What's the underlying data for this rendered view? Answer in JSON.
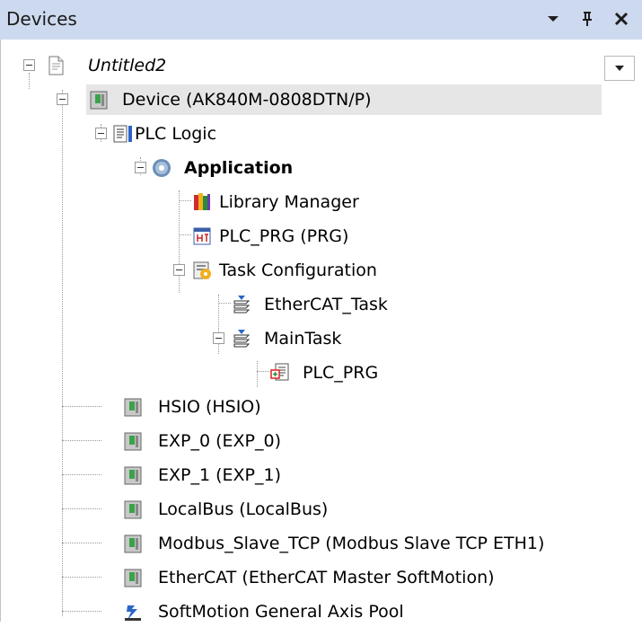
{
  "panel": {
    "title": "Devices"
  },
  "tree": [
    {
      "label": "Untitled2",
      "icon": "project-icon"
    },
    {
      "label": "Device (AK840M-0808DTN/P)",
      "icon": "device-icon"
    },
    {
      "label": "PLC Logic",
      "icon": "plc-logic-icon"
    },
    {
      "label": "Application",
      "icon": "application-gear-icon"
    },
    {
      "label": "Library Manager",
      "icon": "library-manager-icon"
    },
    {
      "label": "PLC_PRG (PRG)",
      "icon": "program-icon"
    },
    {
      "label": "Task Configuration",
      "icon": "task-configuration-icon"
    },
    {
      "label": "EtherCAT_Task",
      "icon": "task-icon"
    },
    {
      "label": "MainTask",
      "icon": "task-icon"
    },
    {
      "label": "PLC_PRG",
      "icon": "program-call-icon"
    },
    {
      "label": "HSIO (HSIO)",
      "icon": "device-icon"
    },
    {
      "label": "EXP_0 (EXP_0)",
      "icon": "device-icon"
    },
    {
      "label": "EXP_1 (EXP_1)",
      "icon": "device-icon"
    },
    {
      "label": "LocalBus (LocalBus)",
      "icon": "device-icon"
    },
    {
      "label": "Modbus_Slave_TCP (Modbus Slave TCP ETH1)",
      "icon": "device-icon"
    },
    {
      "label": "EtherCAT (EtherCAT Master SoftMotion)",
      "icon": "device-icon"
    },
    {
      "label": "SoftMotion General Axis Pool",
      "icon": "axis-pool-icon"
    }
  ]
}
